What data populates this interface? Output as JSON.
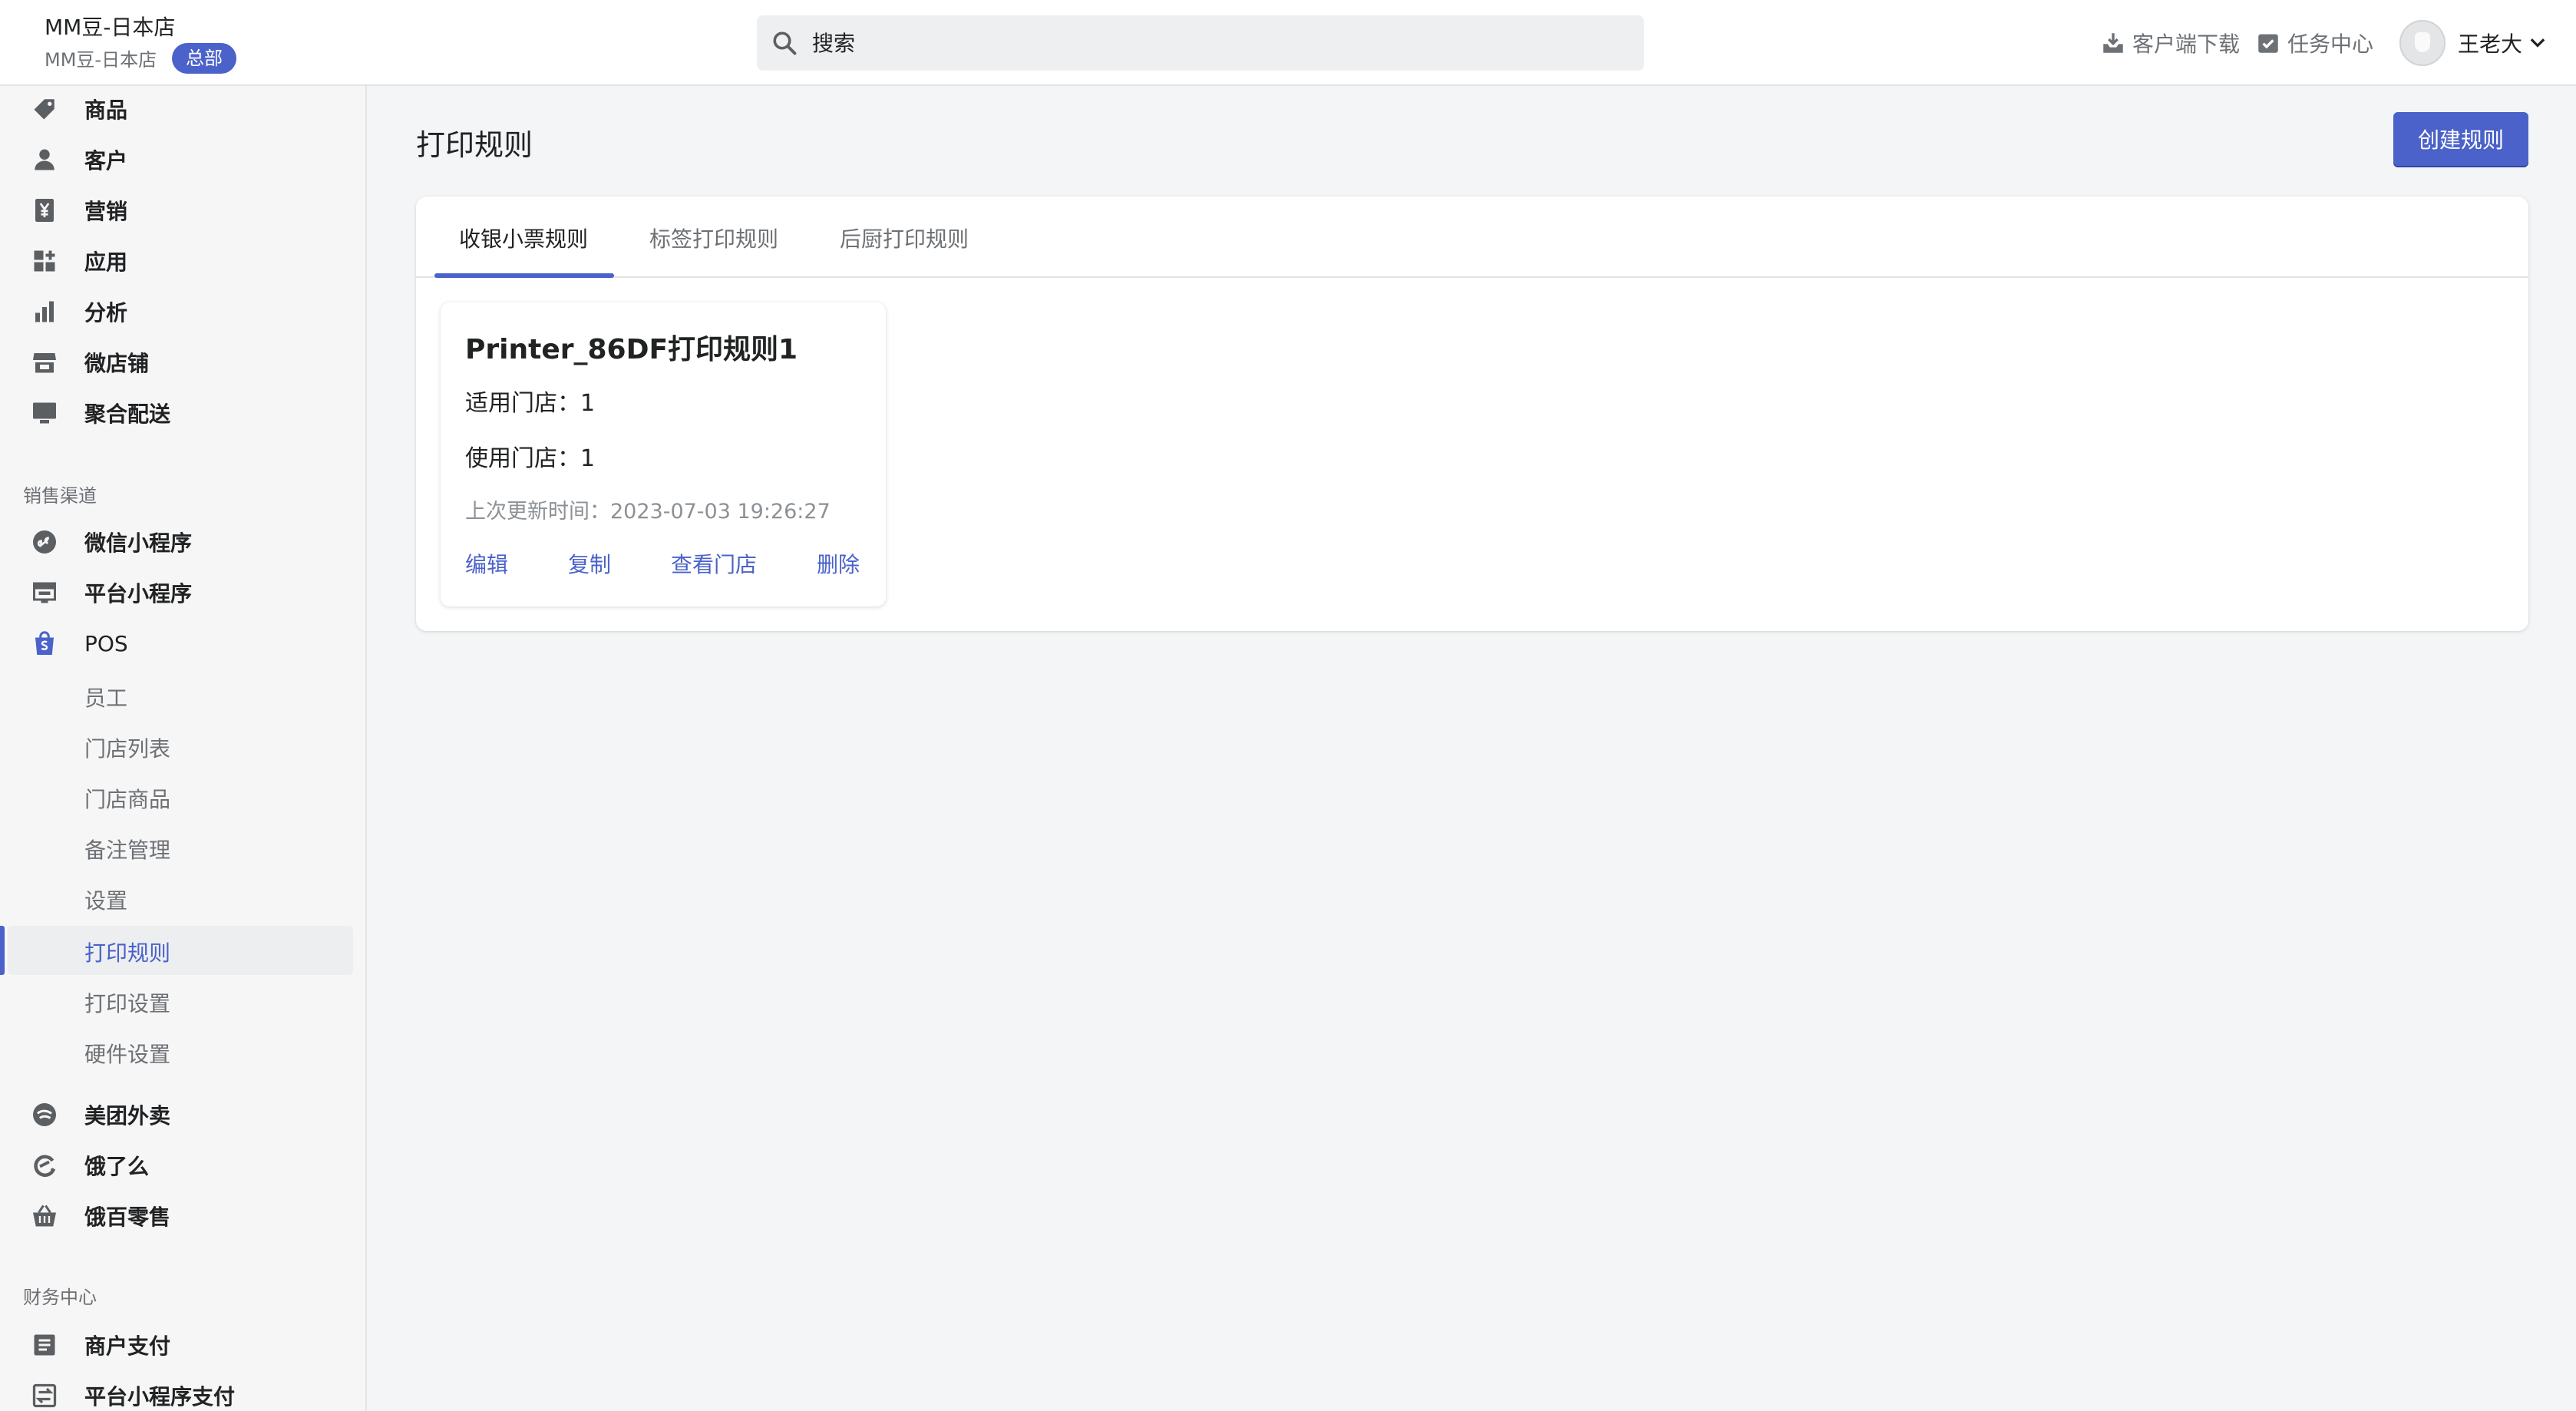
{
  "header": {
    "store_name": "MM豆-日本店",
    "store_sub": "MM豆-日本店",
    "hq_badge": "总部",
    "search_placeholder": "搜索",
    "client_download": "客户端下载",
    "task_center": "任务中心",
    "user_name": "王老大"
  },
  "sidebar": {
    "main_items": [
      {
        "label": "商品",
        "icon": "tag-icon"
      },
      {
        "label": "客户",
        "icon": "person-icon"
      },
      {
        "label": "营销",
        "icon": "yen-icon"
      },
      {
        "label": "应用",
        "icon": "apps-icon"
      },
      {
        "label": "分析",
        "icon": "bar-chart-icon"
      },
      {
        "label": "微店铺",
        "icon": "store-icon"
      },
      {
        "label": "聚合配送",
        "icon": "monitor-icon"
      }
    ],
    "sales_channels_label": "销售渠道",
    "channel_items": [
      {
        "label": "微信小程序",
        "icon": "mini-program-icon"
      },
      {
        "label": "平台小程序",
        "icon": "platform-icon"
      },
      {
        "label": "POS",
        "icon": "shopping-bag-icon"
      }
    ],
    "pos_sub_items": [
      "员工",
      "门店列表",
      "门店商品",
      "备注管理",
      "设置",
      "打印规则",
      "打印设置",
      "硬件设置"
    ],
    "pos_active_sub": "打印规则",
    "delivery_items": [
      {
        "label": "美团外卖",
        "icon": "meituan-icon"
      },
      {
        "label": "饿了么",
        "icon": "eleme-icon"
      },
      {
        "label": "饿百零售",
        "icon": "basket-icon"
      }
    ],
    "finance_label": "财务中心",
    "finance_items": [
      {
        "label": "商户支付",
        "icon": "document-icon"
      },
      {
        "label": "平台小程序支付",
        "icon": "transfer-icon"
      }
    ]
  },
  "main": {
    "page_title": "打印规则",
    "create_button": "创建规则",
    "tabs": [
      "收银小票规则",
      "标签打印规则",
      "后厨打印规则"
    ],
    "active_tab": "收银小票规则",
    "rule_card": {
      "name": "Printer_86DF打印规则1",
      "applicable_stores": "适用门店：1",
      "used_stores": "使用门店：1",
      "last_updated": "上次更新时间：2023-07-03 19:26:27",
      "actions": [
        "编辑",
        "复制",
        "查看门店",
        "删除"
      ]
    }
  },
  "colors": {
    "accent": "#4a62c9",
    "sidebar_bg": "#f6f6f7",
    "page_bg": "#f4f5f6"
  }
}
